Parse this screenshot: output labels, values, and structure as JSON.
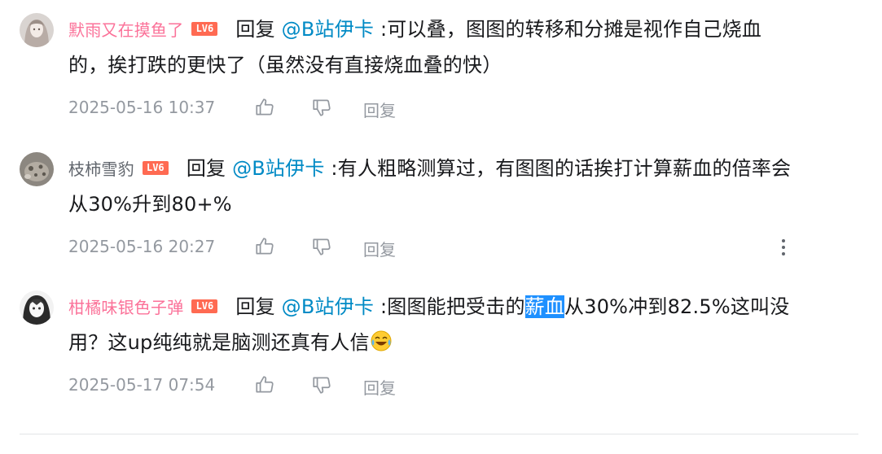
{
  "replies": [
    {
      "username": "默雨又在摸鱼了",
      "username_color": "#fb7299",
      "level": "LV6",
      "reply_prefix": "回复",
      "mention": "@B站伊卡",
      "text_before": " :可以叠，图图的转移和分摊是视作自己烧血",
      "text_line2": "的，挨打跌的更快了（虽然没有直接烧血叠的快）",
      "time": "2025-05-16 10:37",
      "reply_label": "回复"
    },
    {
      "username": "枝柿雪豹",
      "username_color": "#61666d",
      "level": "LV6",
      "reply_prefix": "回复",
      "mention": "@B站伊卡",
      "text_before": " :有人粗略测算过，有图图的话挨打计算薪血的倍率会",
      "text_line2": "从30%升到80+%",
      "time": "2025-05-16 20:27",
      "reply_label": "回复"
    },
    {
      "username": "柑橘味银色子弹",
      "username_color": "#fb7299",
      "level": "LV6",
      "reply_prefix": "回复",
      "mention": "@B站伊卡",
      "text_before": " :图图能把受击的",
      "highlight": "薪血",
      "text_after": "从30%冲到82.5%这叫没",
      "text_line2": "用？这up纯纯就是脑测还真有人信",
      "emoji": "laughing-crying-emoji",
      "time": "2025-05-17 07:54",
      "reply_label": "回复"
    }
  ],
  "icons": {
    "like": "thumbs-up-icon",
    "dislike": "thumbs-down-icon",
    "more": "more-vertical-icon"
  },
  "colors": {
    "pink_username": "#fb7299",
    "mention": "#008ac5",
    "meta_gray": "#9499a0",
    "level_badge": "#ff6a52",
    "highlight": "#1e90ff"
  }
}
